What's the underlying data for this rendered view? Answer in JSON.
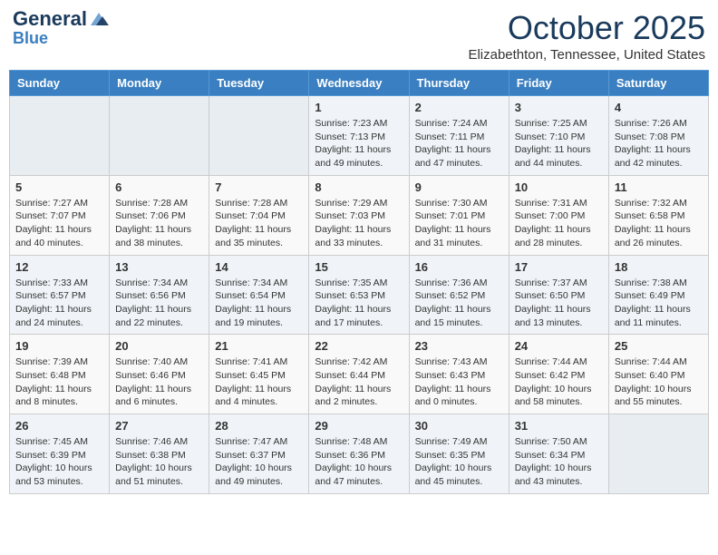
{
  "header": {
    "logo_general": "General",
    "logo_blue": "Blue",
    "month": "October 2025",
    "location": "Elizabethton, Tennessee, United States"
  },
  "days_of_week": [
    "Sunday",
    "Monday",
    "Tuesday",
    "Wednesday",
    "Thursday",
    "Friday",
    "Saturday"
  ],
  "weeks": [
    [
      {
        "day": "",
        "content": ""
      },
      {
        "day": "",
        "content": ""
      },
      {
        "day": "",
        "content": ""
      },
      {
        "day": "1",
        "content": "Sunrise: 7:23 AM\nSunset: 7:13 PM\nDaylight: 11 hours and 49 minutes."
      },
      {
        "day": "2",
        "content": "Sunrise: 7:24 AM\nSunset: 7:11 PM\nDaylight: 11 hours and 47 minutes."
      },
      {
        "day": "3",
        "content": "Sunrise: 7:25 AM\nSunset: 7:10 PM\nDaylight: 11 hours and 44 minutes."
      },
      {
        "day": "4",
        "content": "Sunrise: 7:26 AM\nSunset: 7:08 PM\nDaylight: 11 hours and 42 minutes."
      }
    ],
    [
      {
        "day": "5",
        "content": "Sunrise: 7:27 AM\nSunset: 7:07 PM\nDaylight: 11 hours and 40 minutes."
      },
      {
        "day": "6",
        "content": "Sunrise: 7:28 AM\nSunset: 7:06 PM\nDaylight: 11 hours and 38 minutes."
      },
      {
        "day": "7",
        "content": "Sunrise: 7:28 AM\nSunset: 7:04 PM\nDaylight: 11 hours and 35 minutes."
      },
      {
        "day": "8",
        "content": "Sunrise: 7:29 AM\nSunset: 7:03 PM\nDaylight: 11 hours and 33 minutes."
      },
      {
        "day": "9",
        "content": "Sunrise: 7:30 AM\nSunset: 7:01 PM\nDaylight: 11 hours and 31 minutes."
      },
      {
        "day": "10",
        "content": "Sunrise: 7:31 AM\nSunset: 7:00 PM\nDaylight: 11 hours and 28 minutes."
      },
      {
        "day": "11",
        "content": "Sunrise: 7:32 AM\nSunset: 6:58 PM\nDaylight: 11 hours and 26 minutes."
      }
    ],
    [
      {
        "day": "12",
        "content": "Sunrise: 7:33 AM\nSunset: 6:57 PM\nDaylight: 11 hours and 24 minutes."
      },
      {
        "day": "13",
        "content": "Sunrise: 7:34 AM\nSunset: 6:56 PM\nDaylight: 11 hours and 22 minutes."
      },
      {
        "day": "14",
        "content": "Sunrise: 7:34 AM\nSunset: 6:54 PM\nDaylight: 11 hours and 19 minutes."
      },
      {
        "day": "15",
        "content": "Sunrise: 7:35 AM\nSunset: 6:53 PM\nDaylight: 11 hours and 17 minutes."
      },
      {
        "day": "16",
        "content": "Sunrise: 7:36 AM\nSunset: 6:52 PM\nDaylight: 11 hours and 15 minutes."
      },
      {
        "day": "17",
        "content": "Sunrise: 7:37 AM\nSunset: 6:50 PM\nDaylight: 11 hours and 13 minutes."
      },
      {
        "day": "18",
        "content": "Sunrise: 7:38 AM\nSunset: 6:49 PM\nDaylight: 11 hours and 11 minutes."
      }
    ],
    [
      {
        "day": "19",
        "content": "Sunrise: 7:39 AM\nSunset: 6:48 PM\nDaylight: 11 hours and 8 minutes."
      },
      {
        "day": "20",
        "content": "Sunrise: 7:40 AM\nSunset: 6:46 PM\nDaylight: 11 hours and 6 minutes."
      },
      {
        "day": "21",
        "content": "Sunrise: 7:41 AM\nSunset: 6:45 PM\nDaylight: 11 hours and 4 minutes."
      },
      {
        "day": "22",
        "content": "Sunrise: 7:42 AM\nSunset: 6:44 PM\nDaylight: 11 hours and 2 minutes."
      },
      {
        "day": "23",
        "content": "Sunrise: 7:43 AM\nSunset: 6:43 PM\nDaylight: 11 hours and 0 minutes."
      },
      {
        "day": "24",
        "content": "Sunrise: 7:44 AM\nSunset: 6:42 PM\nDaylight: 10 hours and 58 minutes."
      },
      {
        "day": "25",
        "content": "Sunrise: 7:44 AM\nSunset: 6:40 PM\nDaylight: 10 hours and 55 minutes."
      }
    ],
    [
      {
        "day": "26",
        "content": "Sunrise: 7:45 AM\nSunset: 6:39 PM\nDaylight: 10 hours and 53 minutes."
      },
      {
        "day": "27",
        "content": "Sunrise: 7:46 AM\nSunset: 6:38 PM\nDaylight: 10 hours and 51 minutes."
      },
      {
        "day": "28",
        "content": "Sunrise: 7:47 AM\nSunset: 6:37 PM\nDaylight: 10 hours and 49 minutes."
      },
      {
        "day": "29",
        "content": "Sunrise: 7:48 AM\nSunset: 6:36 PM\nDaylight: 10 hours and 47 minutes."
      },
      {
        "day": "30",
        "content": "Sunrise: 7:49 AM\nSunset: 6:35 PM\nDaylight: 10 hours and 45 minutes."
      },
      {
        "day": "31",
        "content": "Sunrise: 7:50 AM\nSunset: 6:34 PM\nDaylight: 10 hours and 43 minutes."
      },
      {
        "day": "",
        "content": ""
      }
    ]
  ]
}
